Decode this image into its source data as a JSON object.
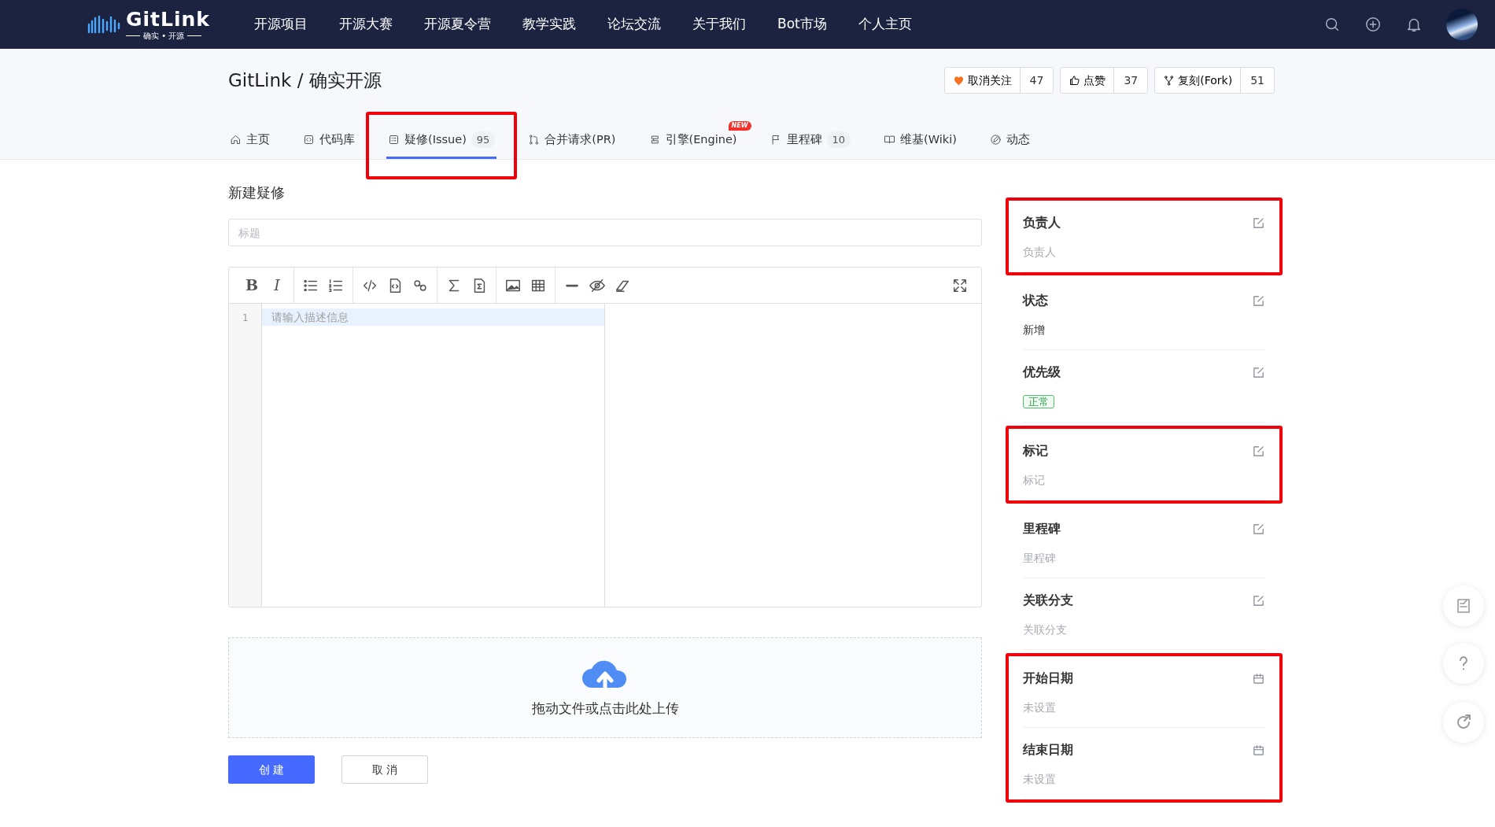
{
  "navbar": {
    "logo": {
      "name": "GitLink",
      "tagline": "确实 • 开源"
    },
    "links": [
      "开源项目",
      "开源大赛",
      "开源夏令营",
      "教学实践",
      "论坛交流",
      "关于我们",
      "Bot市场",
      "个人主页"
    ]
  },
  "repo": {
    "title": "GitLink / 确实开源",
    "actions": [
      {
        "kind": "watch",
        "label": "取消关注",
        "count": "47"
      },
      {
        "kind": "like",
        "label": "点赞",
        "count": "37"
      },
      {
        "kind": "fork",
        "label": "复刻(Fork)",
        "count": "51"
      }
    ]
  },
  "tabs": [
    {
      "label": "主页",
      "selected": false
    },
    {
      "label": "代码库",
      "selected": false
    },
    {
      "label": "疑修(Issue)",
      "count": "95",
      "selected": true,
      "highlighted": true
    },
    {
      "label": "合并请求(PR)",
      "selected": false
    },
    {
      "label": "引擎(Engine)",
      "badge": "NEW",
      "selected": false
    },
    {
      "label": "里程碑",
      "count": "10",
      "selected": false
    },
    {
      "label": "维基(Wiki)",
      "selected": false
    },
    {
      "label": "动态",
      "selected": false
    }
  ],
  "form": {
    "heading": "新建疑修",
    "title_field": {
      "placeholder": "标题"
    },
    "editor": {
      "toolbar_letters": [
        "B",
        "I"
      ],
      "line_number": "1",
      "placeholder": "请输入描述信息"
    },
    "upload": {
      "text": "拖动文件或点击此处上传"
    },
    "buttons": [
      {
        "kind": "primary",
        "label": "创 建"
      },
      {
        "kind": "secondary",
        "label": "取 消"
      }
    ]
  },
  "sidebar": {
    "groups": [
      {
        "highlighted": true,
        "sections": [
          {
            "kind": "edit",
            "title": "负责人",
            "value": {
              "kind": "placeholder",
              "text": "负责人"
            }
          }
        ]
      },
      {
        "sections": [
          {
            "kind": "edit",
            "title": "状态",
            "value": {
              "kind": "text",
              "text": "新增"
            }
          },
          {
            "kind": "edit",
            "title": "优先级",
            "value": {
              "kind": "tag",
              "text": "正常"
            }
          }
        ]
      },
      {
        "highlighted": true,
        "sections": [
          {
            "kind": "edit",
            "title": "标记",
            "value": {
              "kind": "placeholder",
              "text": "标记"
            }
          }
        ]
      },
      {
        "sections": [
          {
            "kind": "edit",
            "title": "里程碑",
            "value": {
              "kind": "placeholder",
              "text": "里程碑"
            }
          },
          {
            "kind": "edit",
            "title": "关联分支",
            "value": {
              "kind": "placeholder",
              "text": "关联分支"
            }
          }
        ]
      },
      {
        "highlighted": true,
        "sections": [
          {
            "kind": "date",
            "title": "开始日期",
            "value": {
              "kind": "placeholder",
              "text": "未设置"
            }
          },
          {
            "kind": "date",
            "title": "结束日期",
            "value": {
              "kind": "placeholder",
              "text": "未设置"
            }
          }
        ]
      }
    ]
  }
}
